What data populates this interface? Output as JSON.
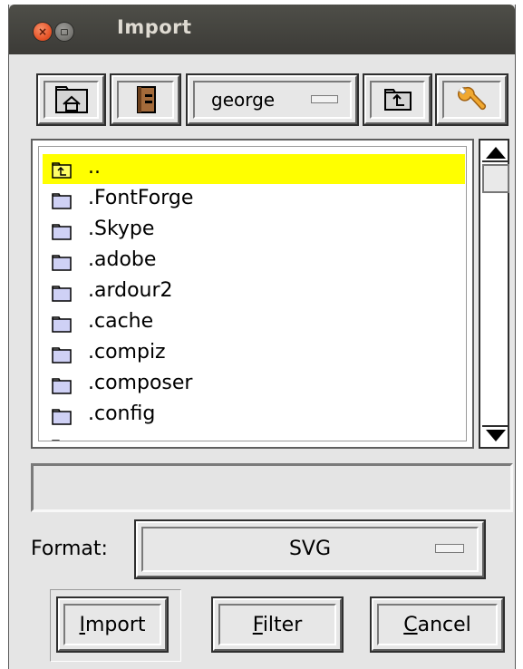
{
  "window": {
    "title": "Import",
    "close_glyph": "×"
  },
  "toolbar": {
    "home_icon": "home-folder-icon",
    "bookmarks_icon": "bookmarks-icon",
    "directory": "george",
    "up_icon": "parent-folder-icon",
    "tools_icon": "wrench-icon"
  },
  "file_list": {
    "items": [
      {
        "label": "..",
        "icon": "parent-folder-icon",
        "selected": true
      },
      {
        "label": ".FontForge",
        "icon": "folder-icon",
        "selected": false
      },
      {
        "label": ".Skype",
        "icon": "folder-icon",
        "selected": false
      },
      {
        "label": ".adobe",
        "icon": "folder-icon",
        "selected": false
      },
      {
        "label": ".ardour2",
        "icon": "folder-icon",
        "selected": false
      },
      {
        "label": ".cache",
        "icon": "folder-icon",
        "selected": false
      },
      {
        "label": ".compiz",
        "icon": "folder-icon",
        "selected": false
      },
      {
        "label": ".composer",
        "icon": "folder-icon",
        "selected": false
      },
      {
        "label": ".config",
        "icon": "folder-icon",
        "selected": false
      }
    ]
  },
  "filename": {
    "value": ""
  },
  "format": {
    "label": "Format:",
    "value": "SVG"
  },
  "buttons": {
    "import": {
      "mnemonic": "I",
      "rest": "mport"
    },
    "filter": {
      "mnemonic": "F",
      "rest": "ilter"
    },
    "cancel": {
      "mnemonic": "C",
      "rest": "ancel"
    }
  },
  "colors": {
    "selection": "#ffff00",
    "folder_fill": "#cfd1f5",
    "titlebar": "#3c3b37"
  }
}
